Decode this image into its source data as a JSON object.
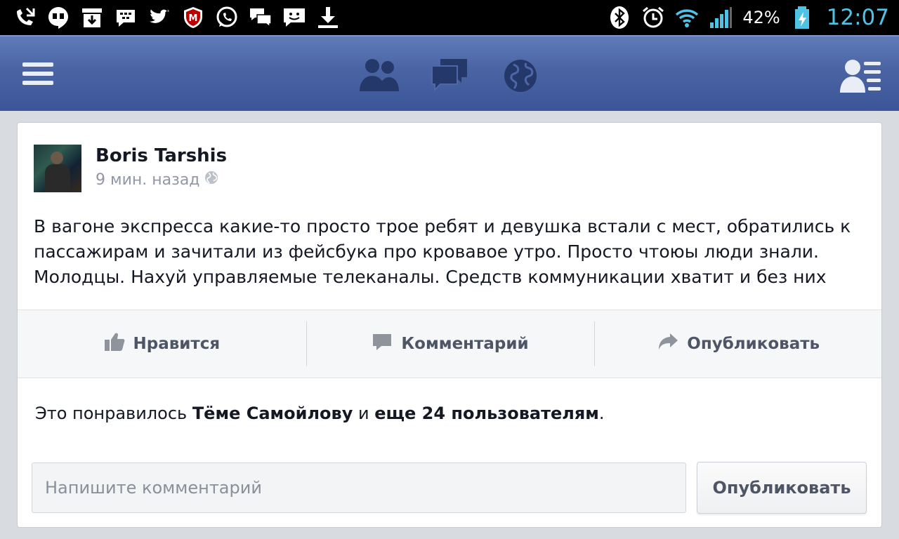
{
  "status_bar": {
    "left_icons": [
      "missed-call-icon",
      "hangouts-icon",
      "download-manager-icon",
      "bbm-icon",
      "twitter-icon",
      "mcafee-icon",
      "whatsapp-icon",
      "chat-bubbles-icon",
      "messenger-icon",
      "download-icon"
    ],
    "right_icons": [
      "bluetooth-icon",
      "alarm-icon",
      "wifi-icon",
      "signal-icon",
      "battery-icon"
    ],
    "battery_percent": "42%",
    "time": "12:07",
    "time_color": "#4fc3e6"
  },
  "topbar": {
    "color": "#3b5699",
    "icons": [
      "menu-icon",
      "friend-requests-icon",
      "messages-icon",
      "notifications-globe-icon",
      "contacts-icon"
    ]
  },
  "post": {
    "author": "Boris Tarshis",
    "time": "9 мин. назад",
    "privacy_icon": "globe-icon",
    "text": "В вагоне экспресса какие-то просто трое ребят и девушка встали с мест, обратились к пассажирам и зачитали из фейсбука про кровавое утро. Просто чтоюы люди знали. Молодцы. Нахуй управляемые телеканалы. Средств коммуникации хватит и без них"
  },
  "actions": {
    "like": "Нравится",
    "comment": "Комментарий",
    "share": "Опубликовать"
  },
  "likes": {
    "prefix": "Это понравилось",
    "name": "Тёме Самойлову",
    "middle": "и",
    "others": "еще 24 пользователям",
    "suffix": "."
  },
  "comment_box": {
    "placeholder": "Напишите комментарий",
    "value": "",
    "submit_label": "Опубликовать"
  }
}
